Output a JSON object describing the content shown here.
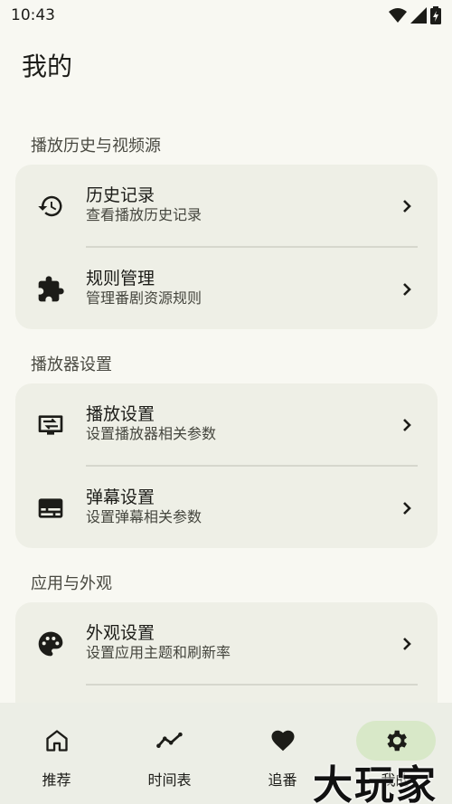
{
  "status_bar": {
    "time": "10:43"
  },
  "page": {
    "title": "我的"
  },
  "sections": [
    {
      "header": "播放历史与视频源",
      "items": [
        {
          "title": "历史记录",
          "subtitle": "查看播放历史记录",
          "icon": "history-icon"
        },
        {
          "title": "规则管理",
          "subtitle": "管理番剧资源规则",
          "icon": "puzzle-icon"
        }
      ]
    },
    {
      "header": "播放器设置",
      "items": [
        {
          "title": "播放设置",
          "subtitle": "设置播放器相关参数",
          "icon": "player-settings-icon"
        },
        {
          "title": "弹幕设置",
          "subtitle": "设置弹幕相关参数",
          "icon": "subtitles-icon"
        }
      ]
    },
    {
      "header": "应用与外观",
      "items": [
        {
          "title": "外观设置",
          "subtitle": "设置应用主题和刷新率",
          "icon": "palette-icon"
        }
      ]
    }
  ],
  "bottom_nav": [
    {
      "label": "推荐",
      "icon": "home-icon",
      "active": false
    },
    {
      "label": "时间表",
      "icon": "timeline-icon",
      "active": false
    },
    {
      "label": "追番",
      "icon": "heart-icon",
      "active": false
    },
    {
      "label": "我的",
      "icon": "gear-icon",
      "active": true
    }
  ],
  "watermark": "大玩家",
  "colors": {
    "background": "#f8f8f2",
    "card": "#eeefe6",
    "nav_background": "#eceee6",
    "active_pill": "#d8e8c8"
  }
}
